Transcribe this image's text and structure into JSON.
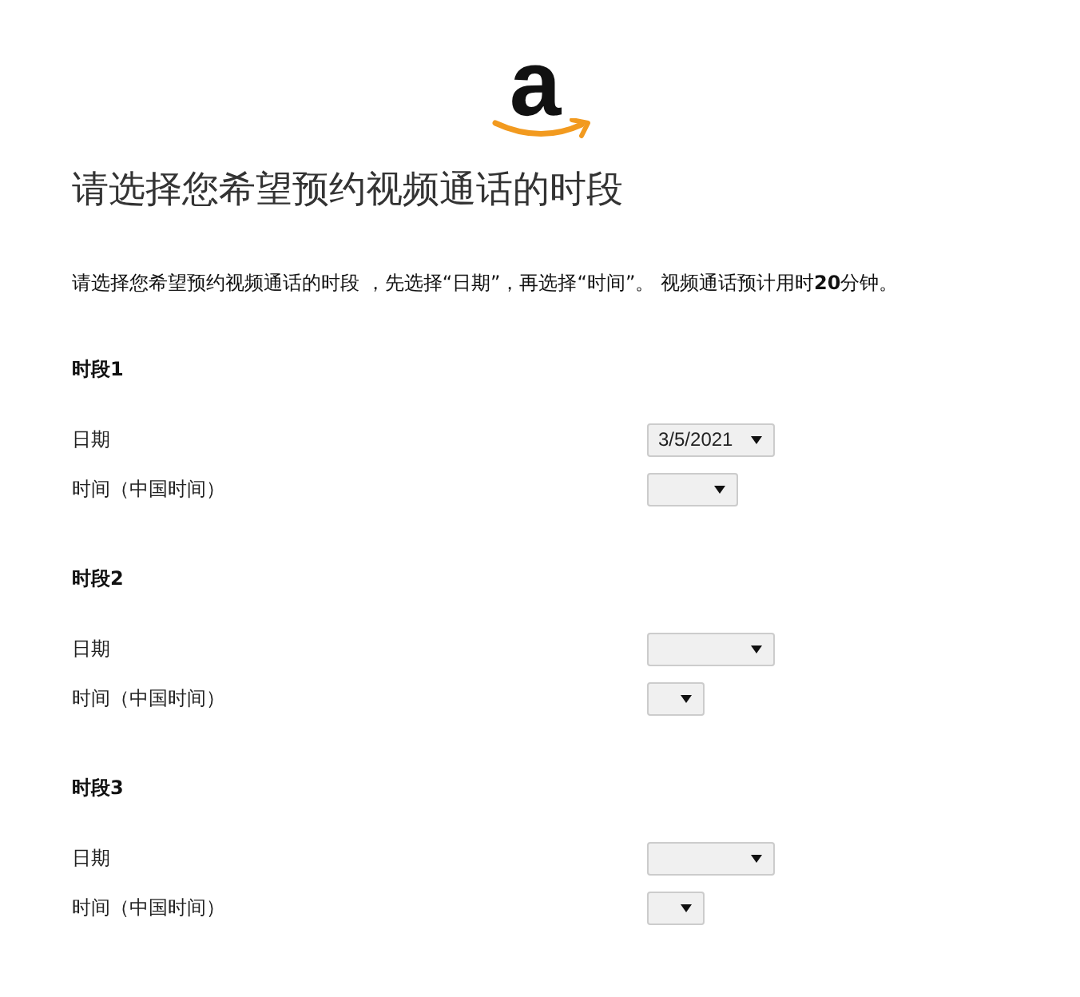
{
  "logo": {
    "text": "a"
  },
  "title": "请选择您希望预约视频通话的时段",
  "intro": "请选择您希望预约视频通话的时段 ，先选择“日期”，再选择“时间”。 视频通话预计用时**20**分钟。",
  "slots": [
    {
      "heading": "时段1",
      "date_label": "日期",
      "date_value": "3/5/2021",
      "time_label": "时间（中国时间）"
    },
    {
      "heading": "时段2",
      "date_label": "日期",
      "time_label": "时间（中国时间）"
    },
    {
      "heading": "时段3",
      "date_label": "日期",
      "time_label": "时间（中国时间）"
    }
  ]
}
